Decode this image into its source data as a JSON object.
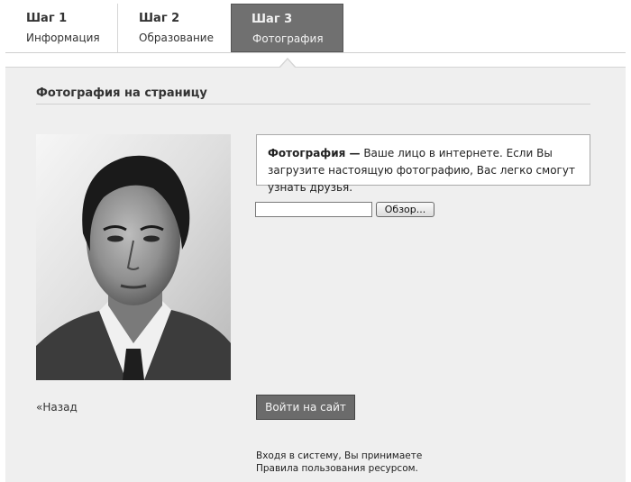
{
  "steps": [
    {
      "num": "Шаг 1",
      "label": "Информация"
    },
    {
      "num": "Шаг 2",
      "label": "Образование"
    },
    {
      "num": "Шаг 3",
      "label": "Фотография"
    }
  ],
  "active_step": 3,
  "section": {
    "title": "Фотография на страницу"
  },
  "info": {
    "bold": "Фотография —",
    "text": " Ваше лицо в интернете. Если Вы загрузите настоящую фотографию, Вас легко смогут узнать друзья."
  },
  "upload": {
    "value": "",
    "browse_label": "Обзор..."
  },
  "back_label": "«Назад",
  "login_label": "Войти на сайт",
  "terms": {
    "line1": "Входя в систему, Вы принимаете",
    "line2": "Правила пользования ресурсом."
  },
  "colors": {
    "active_tab": "#707070",
    "panel_bg": "#efefef",
    "button_bg": "#6b6b6b"
  }
}
